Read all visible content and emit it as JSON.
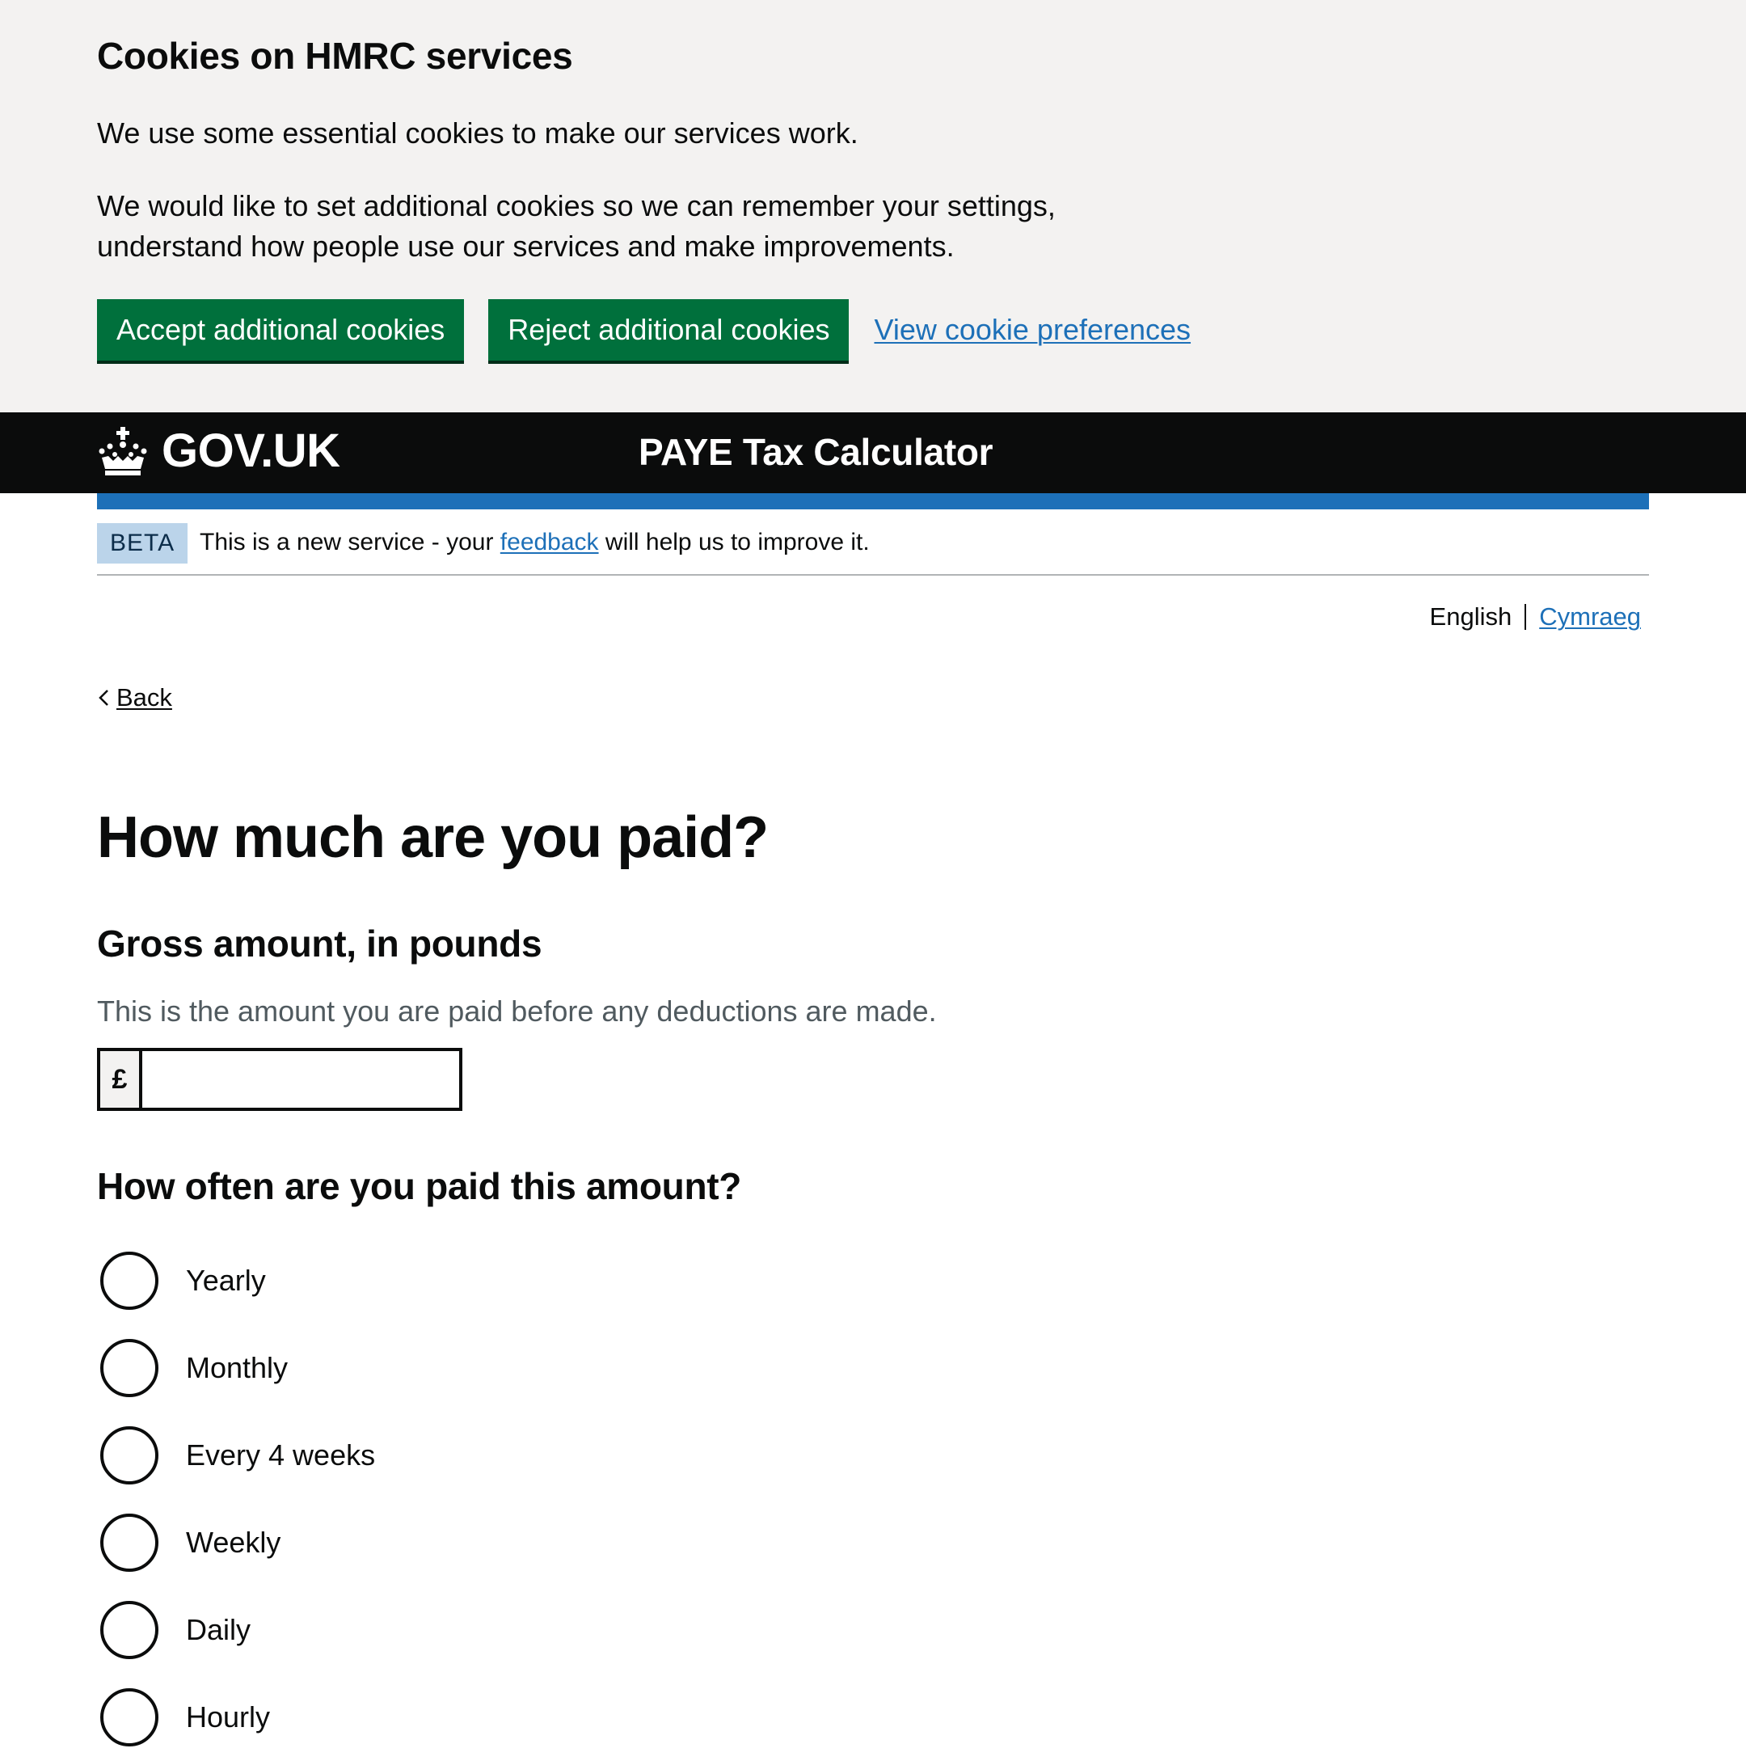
{
  "cookie_banner": {
    "title": "Cookies on HMRC services",
    "paragraph_1": "We use some essential cookies to make our services work.",
    "paragraph_2": "We would like to set additional cookies so we can remember your settings, understand how people use our services and make improvements.",
    "accept_label": "Accept additional cookies",
    "reject_label": "Reject additional cookies",
    "preferences_label": "View cookie preferences"
  },
  "header": {
    "logo_text": "GOV.UK",
    "service_name": "PAYE Tax Calculator"
  },
  "phase_banner": {
    "tag": "BETA",
    "text_before": "This is a new service - your",
    "link": "feedback",
    "text_after": "will help us to improve it."
  },
  "language": {
    "current": "English",
    "other": "Cymraeg"
  },
  "back_label": "Back",
  "page": {
    "heading": "How much are you paid?",
    "amount_label": "Gross amount, in pounds",
    "amount_hint": "This is the amount you are paid before any deductions are made.",
    "currency_prefix": "£",
    "amount_value": "",
    "frequency_legend": "How often are you paid this amount?",
    "frequency_options": [
      "Yearly",
      "Monthly",
      "Every 4 weeks",
      "Weekly",
      "Daily",
      "Hourly"
    ]
  },
  "colors": {
    "button_green": "#00703c",
    "link_blue": "#1d70b8",
    "header_black": "#0b0c0c",
    "banner_grey": "#f3f2f1"
  }
}
